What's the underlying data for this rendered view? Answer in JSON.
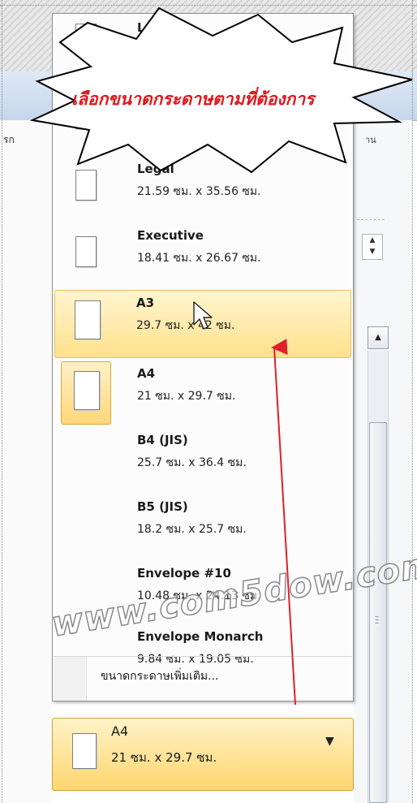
{
  "annotation": {
    "text": "เลือกขนาดกระดาษตามที่ต้องการ"
  },
  "background": {
    "left_tab_text": "รก",
    "right_tab_text": "าน"
  },
  "menu": {
    "top_partial_label": "Le",
    "items": [
      {
        "name": "Legal",
        "size": "21.59 ซม. x 35.56 ซม."
      },
      {
        "name": "Executive",
        "size": "18.41 ซม. x 26.67 ซม."
      },
      {
        "name": "A3",
        "size": "29.7 ซม. x 42 ซม."
      },
      {
        "name": "A4",
        "size": "21 ซม. x 29.7 ซม."
      },
      {
        "name": "B4 (JIS)",
        "size": "25.7 ซม. x 36.4 ซม."
      },
      {
        "name": "B5 (JIS)",
        "size": "18.2 ซม. x 25.7 ซม."
      },
      {
        "name": "Envelope #10",
        "size": "10.48 ซม. x 24.13 ซม."
      },
      {
        "name": "Envelope Monarch",
        "size": "9.84 ซม. x 19.05 ซม."
      }
    ],
    "hovered": "A3",
    "current": "A4",
    "more_sizes_label": "ขนาดกระดาษเพิ่มเติม..."
  },
  "selected": {
    "name": "A4",
    "size": "21 ซม. x 29.7 ซม."
  },
  "watermark": "www.com5dow.com",
  "colors": {
    "annotation_text": "#e2171d",
    "hover_fill": "#ffe18c",
    "arrow": "#e0202a"
  }
}
